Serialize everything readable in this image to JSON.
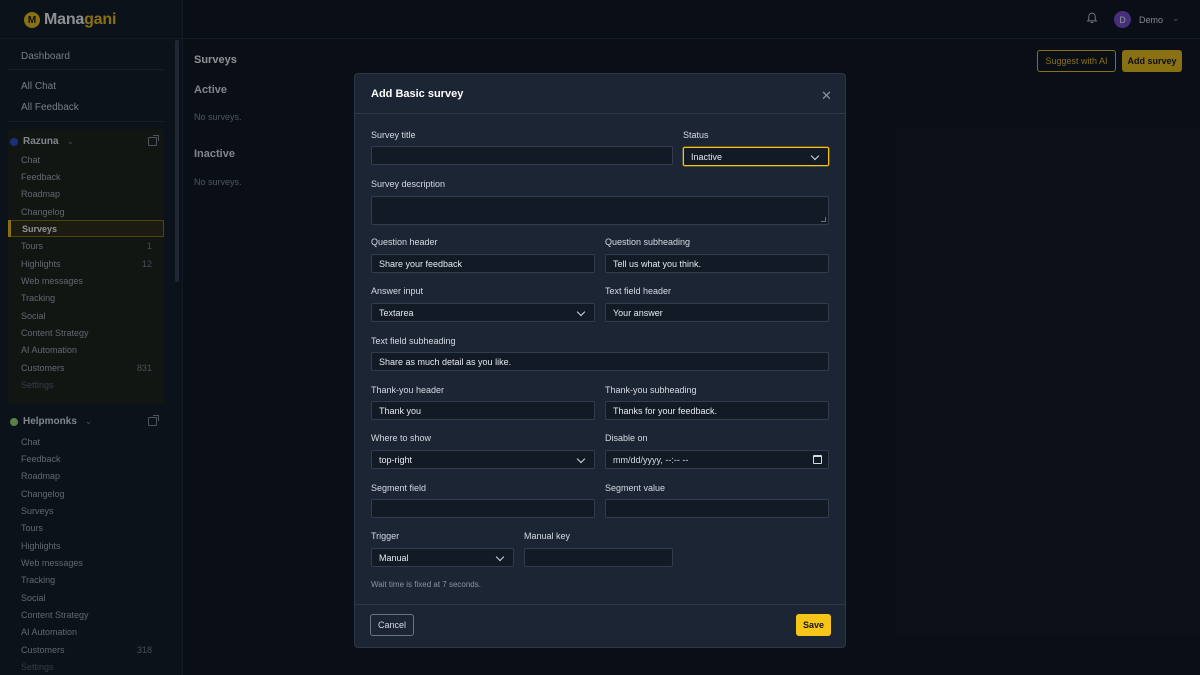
{
  "app": {
    "logo_letter": "M",
    "name_part1": "Mana",
    "name_part2": "gani",
    "brand_color": "#f5c518"
  },
  "header": {
    "user_initial": "D",
    "user_name": "Demo",
    "bell_icon": "bell-icon"
  },
  "sidebar": {
    "top_links": [
      "Dashboard",
      "All Chat",
      "All Feedback"
    ],
    "workspaces": [
      {
        "name": "Razuna",
        "dot_color": "#2b4fd8",
        "items": [
          {
            "label": "Chat",
            "count": ""
          },
          {
            "label": "Feedback",
            "count": ""
          },
          {
            "label": "Roadmap",
            "count": ""
          },
          {
            "label": "Changelog",
            "count": ""
          },
          {
            "label": "Surveys",
            "count": "",
            "active": true
          },
          {
            "label": "Tours",
            "count": "1"
          },
          {
            "label": "Highlights",
            "count": "12"
          },
          {
            "label": "Web messages",
            "count": ""
          },
          {
            "label": "Tracking",
            "count": ""
          },
          {
            "label": "Social",
            "count": ""
          },
          {
            "label": "Content Strategy",
            "count": ""
          },
          {
            "label": "AI Automation",
            "count": ""
          },
          {
            "label": "Customers",
            "count": "831"
          },
          {
            "label": "Settings",
            "count": ""
          }
        ]
      },
      {
        "name": "Helpmonks",
        "dot_color": "#9be37a",
        "items": [
          {
            "label": "Chat",
            "count": ""
          },
          {
            "label": "Feedback",
            "count": ""
          },
          {
            "label": "Roadmap",
            "count": ""
          },
          {
            "label": "Changelog",
            "count": ""
          },
          {
            "label": "Surveys",
            "count": ""
          },
          {
            "label": "Tours",
            "count": ""
          },
          {
            "label": "Highlights",
            "count": ""
          },
          {
            "label": "Web messages",
            "count": ""
          },
          {
            "label": "Tracking",
            "count": ""
          },
          {
            "label": "Social",
            "count": ""
          },
          {
            "label": "Content Strategy",
            "count": ""
          },
          {
            "label": "AI Automation",
            "count": ""
          },
          {
            "label": "Customers",
            "count": "318"
          },
          {
            "label": "Settings",
            "count": ""
          }
        ]
      }
    ]
  },
  "page": {
    "title": "Surveys",
    "active_title": "Active",
    "active_empty": "No surveys.",
    "inactive_title": "Inactive",
    "inactive_empty": "No surveys.",
    "suggest_button": "Suggest with AI",
    "add_button": "Add survey"
  },
  "modal": {
    "title": "Add Basic survey",
    "fields": {
      "survey_title": {
        "label": "Survey title",
        "value": ""
      },
      "status": {
        "label": "Status",
        "value": "Inactive"
      },
      "survey_description": {
        "label": "Survey description",
        "value": ""
      },
      "question_header": {
        "label": "Question header",
        "value": "Share your feedback"
      },
      "question_subheading": {
        "label": "Question subheading",
        "value": "Tell us what you think."
      },
      "answer_input": {
        "label": "Answer input",
        "value": "Textarea"
      },
      "text_field_header": {
        "label": "Text field header",
        "value": "Your answer"
      },
      "text_field_subheading": {
        "label": "Text field subheading",
        "value": "Share as much detail as you like."
      },
      "thankyou_header": {
        "label": "Thank-you header",
        "value": "Thank you"
      },
      "thankyou_subheading": {
        "label": "Thank-you subheading",
        "value": "Thanks for your feedback."
      },
      "where_to_show": {
        "label": "Where to show",
        "value": "top-right"
      },
      "disable_on": {
        "label": "Disable on",
        "value": "mm/dd/yyyy, --:-- --"
      },
      "segment_field": {
        "label": "Segment field",
        "value": ""
      },
      "segment_value": {
        "label": "Segment value",
        "value": ""
      },
      "trigger": {
        "label": "Trigger",
        "value": "Manual"
      },
      "manual_key": {
        "label": "Manual key",
        "value": ""
      }
    },
    "hint": "Wait time is fixed at 7 seconds.",
    "cancel_button": "Cancel",
    "save_button": "Save"
  }
}
